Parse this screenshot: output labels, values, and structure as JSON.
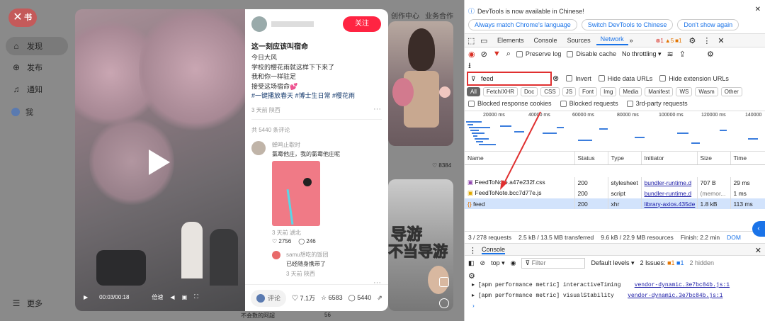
{
  "sidebar": {
    "logo_text": "书",
    "items": [
      {
        "label": "发现",
        "icon": "home-icon"
      },
      {
        "label": "发布",
        "icon": "plus-icon"
      },
      {
        "label": "通知",
        "icon": "bell-icon"
      },
      {
        "label": "我",
        "icon": "avatar"
      }
    ],
    "more_label": "更多"
  },
  "topnav": [
    "创作中心",
    "业务合作"
  ],
  "background": {
    "like_count": "8384",
    "overlay_text_1": "导游",
    "overlay_text_2": "不当导游"
  },
  "video": {
    "time": "00:03/00:18",
    "speed": "倍速"
  },
  "post": {
    "follow_label": "关注",
    "title": "这一刻应该叫宿命",
    "body_lines": [
      "今日大风",
      "学校的樱花雨就这样下下来了",
      "我和你一样驻足",
      "接受这场宿命💕"
    ],
    "tags": "#一键播放春天 #博士生日常 #樱花雨",
    "meta": "3 天前 陕西",
    "comment_count_label": "共 5440 条评论",
    "comments": [
      {
        "name": "蝉鸣止歇时",
        "text": "氯霉他庄，我的氯霉他庄呢",
        "meta": "3 天前 湖北",
        "likes": "2756",
        "replies": "246"
      },
      {
        "name": "samu想吃的饭团",
        "text": "已经随身携带了",
        "meta": "3 天前 陕西",
        "likes": "",
        "replies": "回复"
      },
      {
        "name": "不会数的阿超",
        "text": "",
        "meta": "",
        "likes": "56",
        "replies": ""
      }
    ],
    "comment_btn": "评论",
    "likes": "7.1万",
    "stars": "6583",
    "comments_total": "5440"
  },
  "devtools": {
    "notice": "DevTools is now available in Chinese!",
    "btn_match": "Always match Chrome's language",
    "btn_switch": "Switch DevTools to Chinese",
    "btn_dont": "Don't show again",
    "tabs": [
      "Elements",
      "Console",
      "Sources",
      "Network"
    ],
    "errors": "1",
    "warnings": "5",
    "info": "1",
    "preserve_log": "Preserve log",
    "disable_cache": "Disable cache",
    "throttling": "No throttling",
    "filter_value": "feed",
    "invert": "Invert",
    "hide_data": "Hide data URLs",
    "hide_ext": "Hide extension URLs",
    "types": [
      "All",
      "Fetch/XHR",
      "Doc",
      "CSS",
      "JS",
      "Font",
      "Img",
      "Media",
      "Manifest",
      "WS",
      "Wasm",
      "Other"
    ],
    "blocked_cookies": "Blocked response cookies",
    "blocked_requests": "Blocked requests",
    "third_party": "3rd-party requests",
    "timeline": [
      "20000 ms",
      "40000 ms",
      "60000 ms",
      "80000 ms",
      "100000 ms",
      "120000 ms",
      "140000"
    ],
    "columns": [
      "Name",
      "Status",
      "Type",
      "Initiator",
      "Size",
      "Time"
    ],
    "rows": [
      {
        "name": "FeedToNote.a47e232f.css",
        "status": "200",
        "type": "stylesheet",
        "initiator": "bundler-runtime.d",
        "size": "707 B",
        "time": "29 ms"
      },
      {
        "name": "FeedToNote.bcc7d77e.js",
        "status": "200",
        "type": "script",
        "initiator": "bundler-runtime.d",
        "size": "(memor...",
        "time": "1 ms"
      },
      {
        "name": "feed",
        "status": "200",
        "type": "xhr",
        "initiator": "library-axios.435de",
        "size": "1.8 kB",
        "time": "113 ms"
      }
    ],
    "status_bar": [
      "3 / 278 requests",
      "2.5 kB / 13.5 MB transferred",
      "9.6 kB / 22.9 MB resources",
      "Finish: 2.2 min",
      "DOM"
    ],
    "console_label": "Console",
    "context": "top",
    "console_filter": "Filter",
    "levels": "Default levels",
    "issues": "2 Issues:",
    "issues_a": "1",
    "issues_b": "1",
    "hidden": "2 hidden",
    "log_lines": [
      {
        "text": "[apm performance metric] interactiveTiming",
        "link": "vendor-dynamic.3e7bc84b.js:1"
      },
      {
        "text": "[apm performance metric] visualStability",
        "link": "vendor-dynamic.3e7bc84b.js:1"
      }
    ]
  },
  "colors": {
    "accent": "#ff2442",
    "devtools_blue": "#1a73e8",
    "highlight": "#e03030"
  }
}
